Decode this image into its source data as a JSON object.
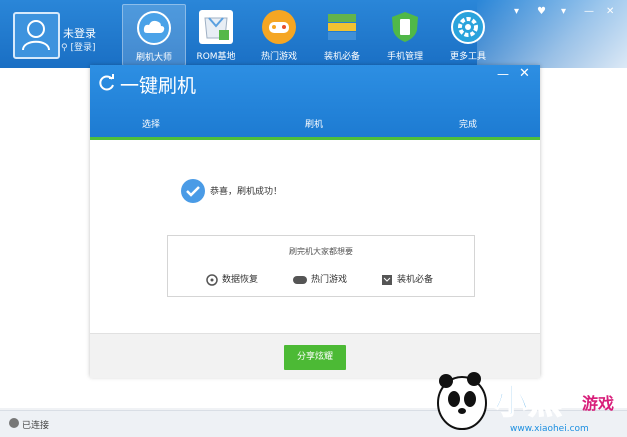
{
  "user": {
    "name": "未登录",
    "login_link": "[登录]"
  },
  "nav": [
    {
      "label": "刷机大师",
      "color": "#ffffff",
      "active": true
    },
    {
      "label": "ROM基地",
      "color": "#ffffff"
    },
    {
      "label": "热门游戏",
      "color": "#f5a623"
    },
    {
      "label": "装机必备",
      "color": "#63b34c"
    },
    {
      "label": "手机管理",
      "color": "#50b848"
    },
    {
      "label": "更多工具",
      "color": "#2aa3dc"
    }
  ],
  "window_controls": [
    "▾",
    "♥",
    "▾",
    "—",
    "✕"
  ],
  "dialog": {
    "title": "一键刷机",
    "min": "—",
    "close": "✕",
    "steps": [
      "选择",
      "刷机",
      "完成"
    ],
    "success_text": "恭喜，刷机成功！",
    "share_title": "刷完机大家都想要",
    "share_items": [
      "数据恢复",
      "热门游戏",
      "装机必备"
    ],
    "share_button": "分享炫耀"
  },
  "status": {
    "text": "已连接"
  },
  "watermark": {
    "text": "小黑游戏",
    "url": "www.xiaohei.com"
  }
}
